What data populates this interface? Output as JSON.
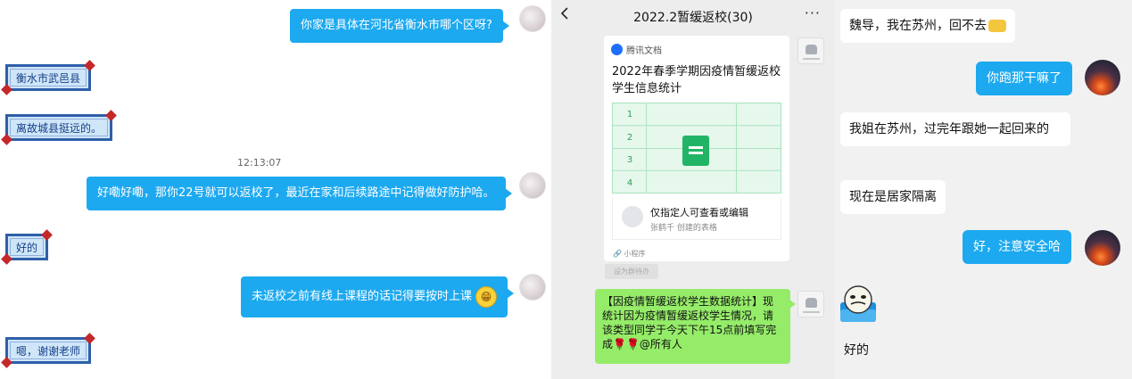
{
  "left_chat": {
    "messages": [
      {
        "side": "right",
        "text": "你家是具体在河北省衡水市哪个区呀?"
      },
      {
        "side": "left",
        "text": "衡水市武邑县"
      },
      {
        "side": "left",
        "text": "离故城县挺远的。"
      },
      {
        "side": "right",
        "text": "好嘞好嘞，那你22号就可以返校了，最近在家和后续路途中记得做好防护哈。"
      },
      {
        "side": "left",
        "text": "好的"
      },
      {
        "side": "right",
        "text": "未返校之前有线上课程的话记得要按时上课"
      },
      {
        "side": "left",
        "text": "嗯，谢谢老师"
      }
    ],
    "timestamp": "12:13:07",
    "emoji_name": "grin-emoji"
  },
  "group_chat": {
    "title": "2022.2暂缓返校(30)",
    "more_label": "···",
    "card": {
      "source": "腾讯文档",
      "title": "2022年春季学期因疫情暂缓返校学生信息统计",
      "rows": [
        "1",
        "2",
        "3",
        "4"
      ],
      "permission": "仅指定人可查看或编辑",
      "creator": "张鹤千 创建的表格",
      "mini_program": "小程序"
    },
    "pill_label": "设为群待办",
    "notice": "【因疫情暂缓返校学生数据统计】现统计因为疫情暂缓返校学生情况，请该类型同学于今天下午15点前填写完成🌹🌹@所有人"
  },
  "right_chat": {
    "messages": [
      {
        "side": "left",
        "text": "魏导，我在苏州，回不去"
      },
      {
        "side": "right",
        "text": "你跑那干嘛了"
      },
      {
        "side": "left",
        "text": "我姐在苏州，过完年跟她一起回来的"
      },
      {
        "side": "left",
        "text": "现在是居家隔离"
      },
      {
        "side": "right",
        "text": "好，注意安全哈"
      },
      {
        "side": "left",
        "text": "好的"
      }
    ]
  },
  "colors": {
    "blue_bubble": "#1da9ef",
    "green_bubble": "#95ec69",
    "frame_border": "#2f5fa8",
    "frame_fill": "#cfe6f9",
    "chat_bg": "#ededed"
  }
}
